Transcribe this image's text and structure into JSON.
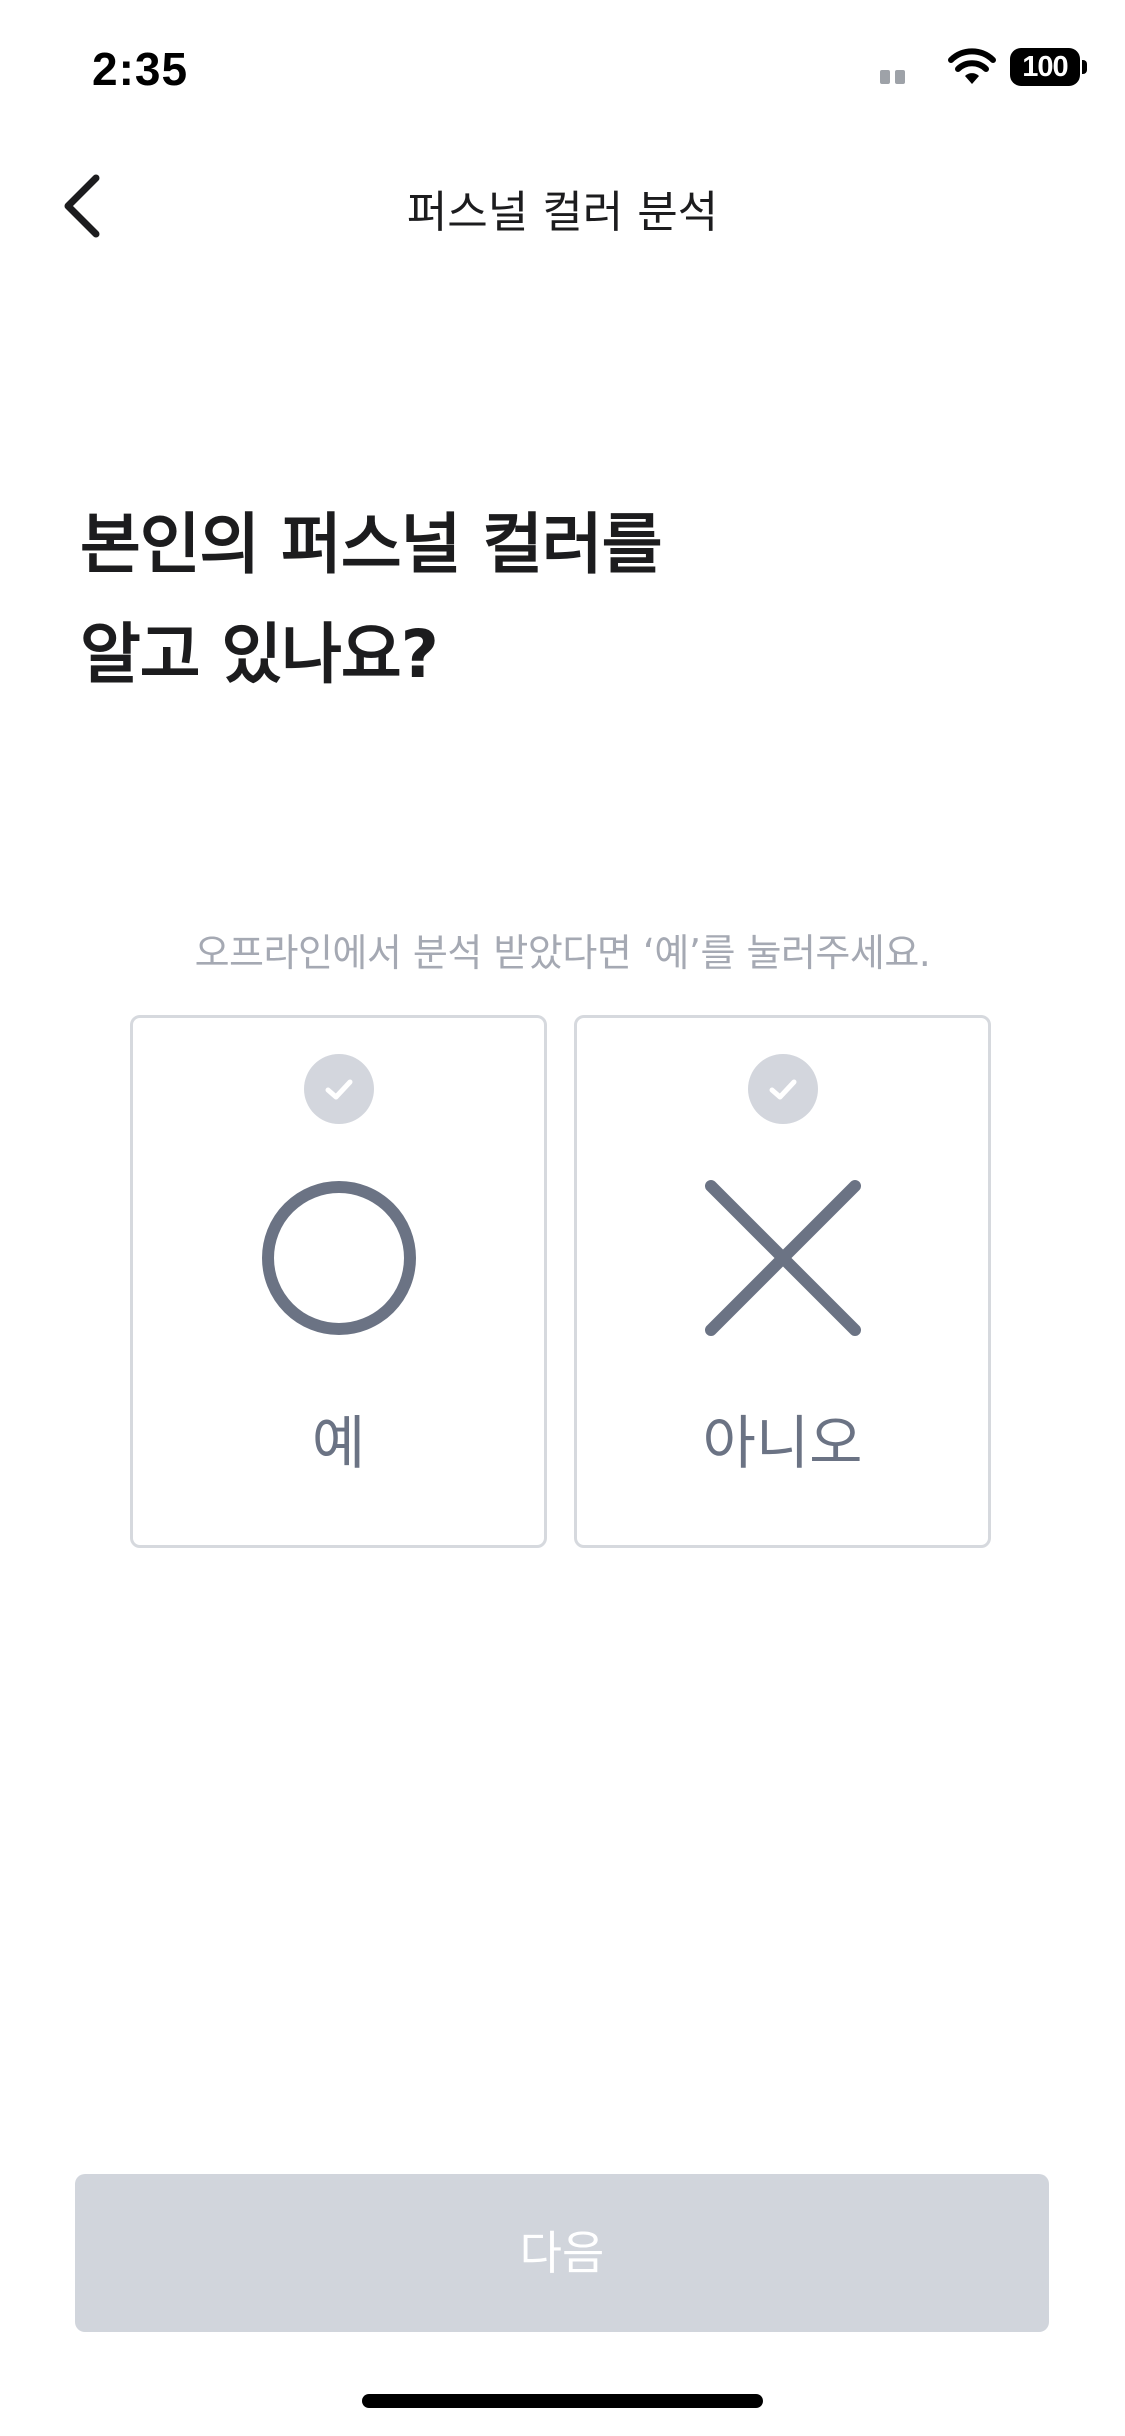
{
  "status_bar": {
    "time": "2:35",
    "battery": "100",
    "icons": [
      "signal-icon",
      "wifi-icon",
      "battery-icon"
    ]
  },
  "nav": {
    "title": "퍼스널 컬러 분석",
    "back_icon": "chevron-left-icon"
  },
  "question": {
    "line1": "본인의 퍼스널 컬러를",
    "line2": "알고 있나요?"
  },
  "hint": "오프라인에서 분석 받았다면 ‘예’를 눌러주세요.",
  "options": [
    {
      "label": "예",
      "icon": "circle-o-icon",
      "selected": false
    },
    {
      "label": "아니오",
      "icon": "x-mark-icon",
      "selected": false
    }
  ],
  "next_button": {
    "label": "다음",
    "enabled": false
  },
  "colors": {
    "symbol": "#6b7384",
    "badge": "#d3d6dd",
    "card_border": "#d6d9de",
    "button_disabled": "#d1d5dc",
    "hint_text": "#a5a9b3"
  }
}
